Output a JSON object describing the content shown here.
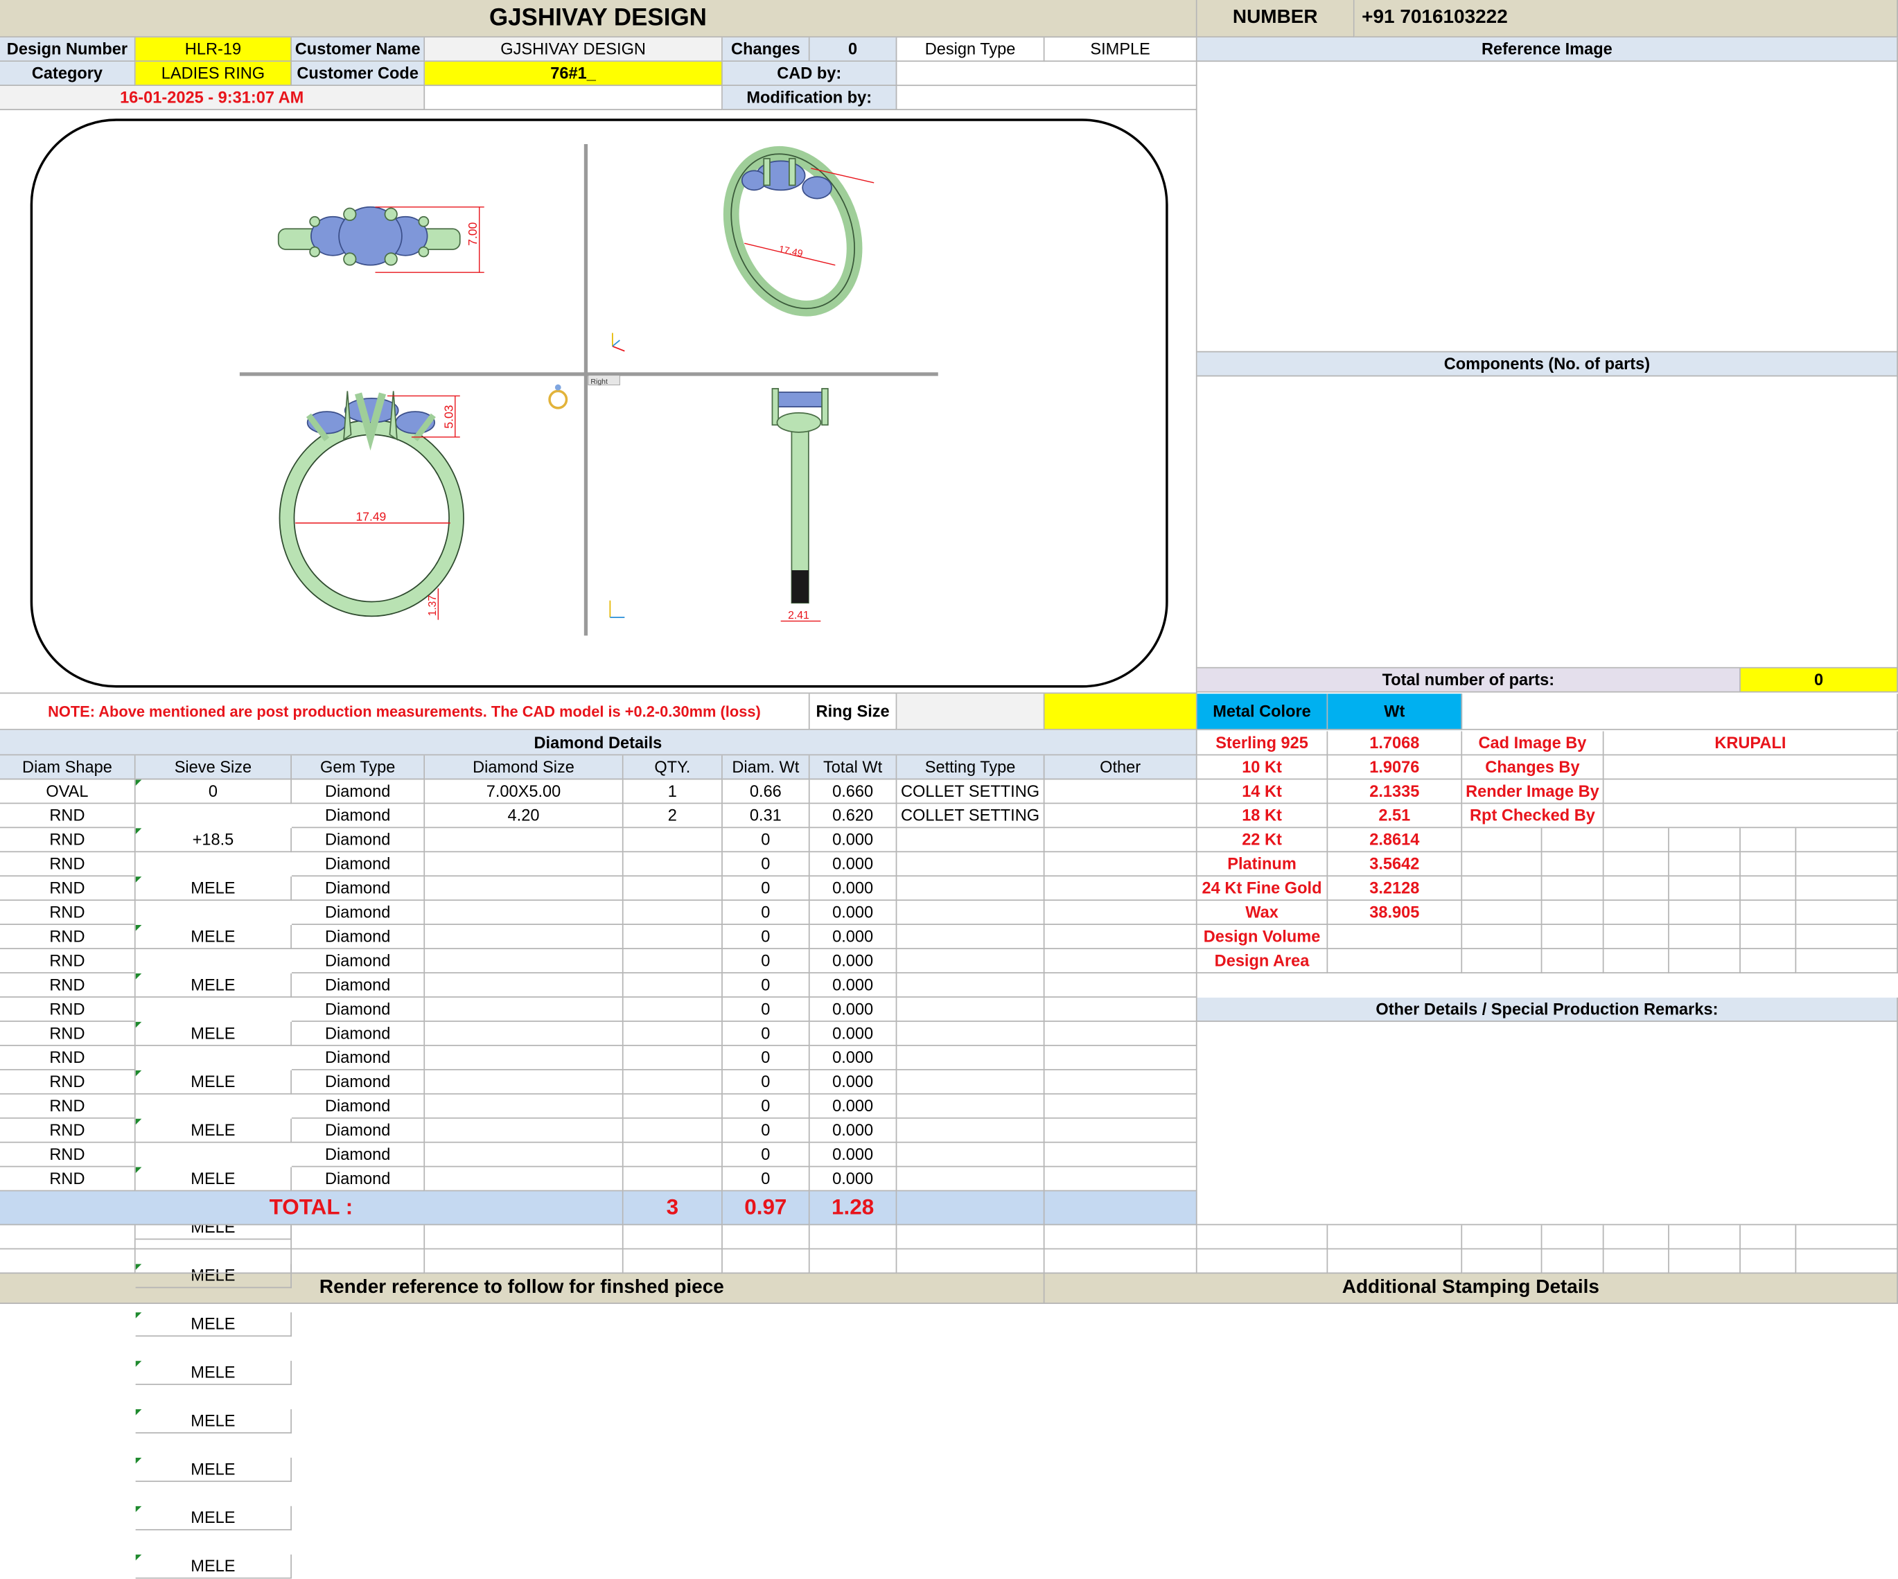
{
  "header": {
    "title": "GJSHIVAY DESIGN",
    "number_label": "NUMBER",
    "number_value": "+91 7016103222"
  },
  "info": {
    "design_number_label": "Design Number",
    "design_number": "HLR-19",
    "customer_name_label": "Customer Name",
    "customer_name": "GJSHIVAY DESIGN",
    "changes_label": "Changes",
    "changes_value": "0",
    "design_type_label": "Design Type",
    "design_type": "SIMPLE",
    "category_label": "Category",
    "category": "LADIES RING",
    "customer_code_label": "Customer Code",
    "customer_code": "76#1_",
    "cad_by_label": "CAD by:",
    "modification_by_label": "Modification by:",
    "date": "16-01-2025 - 9:31:07 AM"
  },
  "cad_drawing": {
    "top_width_dim": "7.00",
    "side_height_dim": "5.03",
    "inner_diameter_dim": "17.49",
    "shank_thickness_dim": "1.37",
    "shank_width_dim": "2.41",
    "persp_diameter_dim": "17.49",
    "viewport_label": "Right",
    "stone_color": "#7f97d9",
    "metal_color": "#b9e2b3",
    "dim_color": "#e8141b"
  },
  "note": "NOTE: Above mentioned are post production measurements. The CAD model is +0.2-0.30mm (loss)",
  "ring_size_label": "Ring Size",
  "diamond_details": {
    "title": "Diamond Details",
    "columns": [
      "Diam Shape",
      "Sieve Size",
      "Gem Type",
      "Diamond Size",
      "QTY.",
      "Diam. Wt",
      "Total Wt",
      "Setting Type",
      "Other"
    ],
    "rows": [
      [
        "OVAL",
        "0",
        "Diamond",
        "7.00X5.00",
        "1",
        "0.66",
        "0.660",
        "COLLET SETTING",
        ""
      ],
      [
        "RND",
        "+18.5",
        "Diamond",
        "4.20",
        "2",
        "0.31",
        "0.620",
        "COLLET SETTING",
        ""
      ],
      [
        "RND",
        "MELE",
        "Diamond",
        "",
        "",
        "0",
        "0.000",
        "",
        ""
      ],
      [
        "RND",
        "MELE",
        "Diamond",
        "",
        "",
        "0",
        "0.000",
        "",
        ""
      ],
      [
        "RND",
        "MELE",
        "Diamond",
        "",
        "",
        "0",
        "0.000",
        "",
        ""
      ],
      [
        "RND",
        "MELE",
        "Diamond",
        "",
        "",
        "0",
        "0.000",
        "",
        ""
      ],
      [
        "RND",
        "MELE",
        "Diamond",
        "",
        "",
        "0",
        "0.000",
        "",
        ""
      ],
      [
        "RND",
        "MELE",
        "Diamond",
        "",
        "",
        "0",
        "0.000",
        "",
        ""
      ],
      [
        "RND",
        "MELE",
        "Diamond",
        "",
        "",
        "0",
        "0.000",
        "",
        ""
      ],
      [
        "RND",
        "MELE",
        "Diamond",
        "",
        "",
        "0",
        "0.000",
        "",
        ""
      ],
      [
        "RND",
        "MELE",
        "Diamond",
        "",
        "",
        "0",
        "0.000",
        "",
        ""
      ],
      [
        "RND",
        "MELE",
        "Diamond",
        "",
        "",
        "0",
        "0.000",
        "",
        ""
      ],
      [
        "RND",
        "MELE",
        "Diamond",
        "",
        "",
        "0",
        "0.000",
        "",
        ""
      ],
      [
        "RND",
        "MELE",
        "Diamond",
        "",
        "",
        "0",
        "0.000",
        "",
        ""
      ],
      [
        "RND",
        "MELE",
        "Diamond",
        "",
        "",
        "0",
        "0.000",
        "",
        ""
      ],
      [
        "RND",
        "MELE",
        "Diamond",
        "",
        "",
        "0",
        "0.000",
        "",
        ""
      ],
      [
        "RND",
        "MELE",
        "Diamond",
        "",
        "",
        "0",
        "0.000",
        "",
        ""
      ]
    ],
    "total_label": "TOTAL :",
    "total_qty": "3",
    "total_diam_wt": "0.97",
    "total_wt": "1.28"
  },
  "right_panel": {
    "reference_image_label": "Reference Image",
    "components_label": "Components (No. of parts)",
    "total_parts_label": "Total number of parts:",
    "total_parts_value": "0",
    "metal_colore_label": "Metal Colore",
    "wt_label": "Wt",
    "metals": [
      {
        "name": "Sterling 925",
        "wt": "1.7068"
      },
      {
        "name": "10 Kt",
        "wt": "1.9076"
      },
      {
        "name": "14 Kt",
        "wt": "2.1335"
      },
      {
        "name": "18 Kt",
        "wt": "2.51"
      },
      {
        "name": "22 Kt",
        "wt": "2.8614"
      },
      {
        "name": "Platinum",
        "wt": "3.5642"
      },
      {
        "name": "24 Kt Fine Gold",
        "wt": "3.2128"
      },
      {
        "name": "Wax",
        "wt": "38.905"
      },
      {
        "name": "Design Volume",
        "wt": ""
      },
      {
        "name": "Design Area",
        "wt": ""
      }
    ],
    "cad_image_by_label": "Cad Image By",
    "cad_image_by": "KRUPALI",
    "changes_by_label": "Changes By",
    "render_image_by_label": "Render Image By",
    "rpt_checked_by_label": "Rpt Checked By",
    "other_details_label": "Other Details / Special Production Remarks:"
  },
  "footer": {
    "render_reference": "Render reference to follow for finshed piece",
    "stamping": "Additional Stamping Details"
  }
}
